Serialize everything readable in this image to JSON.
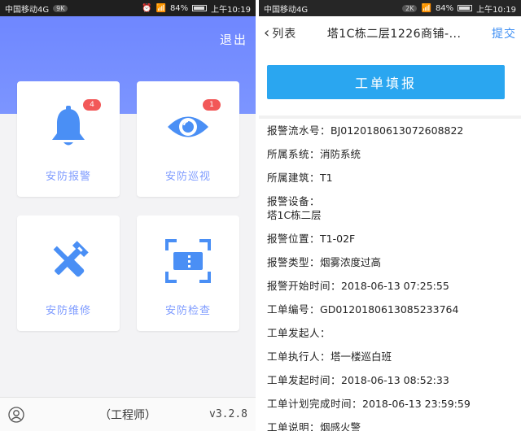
{
  "left": {
    "status": {
      "carrier": "中国移动4G",
      "pill": "9K",
      "battery": "84%",
      "time": "上午10:19"
    },
    "logout": "退出",
    "cards": [
      {
        "label": "安防报警",
        "badge": "4",
        "icon": "bell-icon"
      },
      {
        "label": "安防巡视",
        "badge": "1",
        "icon": "eye-icon"
      },
      {
        "label": "安防维修",
        "badge": "",
        "icon": "wrench-screwdriver-icon"
      },
      {
        "label": "安防检查",
        "badge": "",
        "icon": "scan-ticket-icon"
      }
    ],
    "bottom": {
      "role": "（工程师）",
      "version": "v3.2.8"
    },
    "colors": {
      "hero": "#7c95ff",
      "label": "#7f9cff",
      "icon": "#4a8ff5",
      "badge": "#f25858"
    }
  },
  "right": {
    "status": {
      "carrier": "中国移动4G",
      "pill": "2K",
      "battery": "84%",
      "time": "上午10:19"
    },
    "nav": {
      "back": "列表",
      "title": "塔1C栋二层1226商铺-...",
      "submit": "提交"
    },
    "fill_button": "工单填报",
    "fields": [
      {
        "key": "报警流水号：",
        "value": "BJ0120180613072608822"
      },
      {
        "key": "所属系统：",
        "value": "消防系统"
      },
      {
        "key": "所属建筑：",
        "value": "T1"
      },
      {
        "key": "报警设备：",
        "value": "塔1C栋二层"
      },
      {
        "key": "报警位置：",
        "value": "T1-02F"
      },
      {
        "key": "报警类型：",
        "value": "烟雾浓度过高"
      },
      {
        "key": "报警开始时间：",
        "value": "2018-06-13 07:25:55"
      },
      {
        "key": "工单编号：",
        "value": "GD0120180613085233764"
      },
      {
        "key": "工单发起人：",
        "value": ""
      },
      {
        "key": "工单执行人：",
        "value": "塔一楼巡白班"
      },
      {
        "key": "工单发起时间：",
        "value": "2018-06-13 08:52:33"
      },
      {
        "key": "工单计划完成时间：",
        "value": "2018-06-13 23:59:59"
      },
      {
        "key": "工单说明：",
        "value": "烟感火警"
      }
    ],
    "colors": {
      "button": "#2aa6f0",
      "submit": "#3b8df4"
    }
  }
}
